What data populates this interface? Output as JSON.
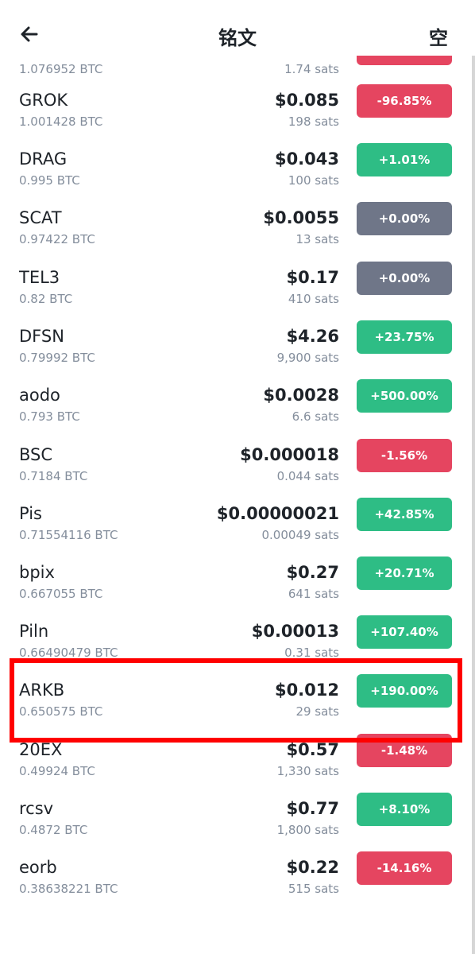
{
  "header": {
    "title": "铭文",
    "right_icon": "空"
  },
  "rows": [
    {
      "name": "",
      "vol": "1.076952 BTC",
      "price": "",
      "sats": "1.74 sats",
      "change": "",
      "dir": "down"
    },
    {
      "name": "GROK",
      "vol": "1.001428 BTC",
      "price": "$0.085",
      "sats": "198 sats",
      "change": "-96.85%",
      "dir": "down"
    },
    {
      "name": "DRAG",
      "vol": "0.995 BTC",
      "price": "$0.043",
      "sats": "100 sats",
      "change": "+1.01%",
      "dir": "up"
    },
    {
      "name": "SCAT",
      "vol": "0.97422 BTC",
      "price": "$0.0055",
      "sats": "13 sats",
      "change": "+0.00%",
      "dir": "flat"
    },
    {
      "name": "TEL3",
      "vol": "0.82 BTC",
      "price": "$0.17",
      "sats": "410 sats",
      "change": "+0.00%",
      "dir": "flat"
    },
    {
      "name": "DFSN",
      "vol": "0.79992 BTC",
      "price": "$4.26",
      "sats": "9,900 sats",
      "change": "+23.75%",
      "dir": "up"
    },
    {
      "name": "aodo",
      "vol": "0.793 BTC",
      "price": "$0.0028",
      "sats": "6.6 sats",
      "change": "+500.00%",
      "dir": "up"
    },
    {
      "name": "BSC",
      "vol": "0.7184 BTC",
      "price": "$0.000018",
      "sats": "0.044 sats",
      "change": "-1.56%",
      "dir": "down"
    },
    {
      "name": "Pis",
      "vol": "0.71554116 BTC",
      "price": "$0.00000021",
      "sats": "0.00049 sats",
      "change": "+42.85%",
      "dir": "up"
    },
    {
      "name": "bpix",
      "vol": "0.667055 BTC",
      "price": "$0.27",
      "sats": "641 sats",
      "change": "+20.71%",
      "dir": "up"
    },
    {
      "name": "Piln",
      "vol": "0.66490479 BTC",
      "price": "$0.00013",
      "sats": "0.31 sats",
      "change": "+107.40%",
      "dir": "up"
    },
    {
      "name": "ARKB",
      "vol": "0.650575 BTC",
      "price": "$0.012",
      "sats": "29 sats",
      "change": "+190.00%",
      "dir": "up"
    },
    {
      "name": "20EX",
      "vol": "0.49924 BTC",
      "price": "$0.57",
      "sats": "1,330 sats",
      "change": "-1.48%",
      "dir": "down"
    },
    {
      "name": "rcsv",
      "vol": "0.4872 BTC",
      "price": "$0.77",
      "sats": "1,800 sats",
      "change": "+8.10%",
      "dir": "up"
    },
    {
      "name": "eorb",
      "vol": "0.38638221 BTC",
      "price": "$0.22",
      "sats": "515 sats",
      "change": "-14.16%",
      "dir": "down"
    }
  ]
}
